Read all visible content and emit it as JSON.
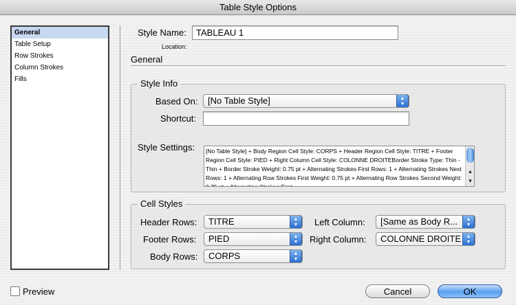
{
  "window": {
    "title": "Table Style Options"
  },
  "sidebar": {
    "items": [
      {
        "label": "General",
        "selected": true
      },
      {
        "label": "Table Setup"
      },
      {
        "label": "Row Strokes"
      },
      {
        "label": "Column Strokes"
      },
      {
        "label": "Fills"
      }
    ]
  },
  "style_name": {
    "label": "Style Name:",
    "value": "TABLEAU 1"
  },
  "location": {
    "label": "Location:"
  },
  "section_title": "General",
  "style_info": {
    "title": "Style Info",
    "based_on_label": "Based On:",
    "based_on_value": "[No Table Style]",
    "shortcut_label": "Shortcut:",
    "shortcut_value": "",
    "settings_label": "Style Settings:",
    "settings_text": "[No Table Style] + Body Region Cell Style: CORPS + Header Region Cell Style: TITRE + Footer Region Cell Style: PIED + Right Column Cell Style: COLONNE DROITEBorder Stroke Type: Thin - Thin + Border Stroke Weight: 0.75 pt + Alternating Strokes First Rows: 1 + Alternating Strokes Next Rows: 1 + Alternating Row Strokes First Weight: 0.75 pt + Alternating Row Strokes Second Weight: 0.75 pt + Alternating Strokes First"
  },
  "cell_styles": {
    "title": "Cell Styles",
    "header_rows_label": "Header Rows:",
    "header_rows_value": "TITRE",
    "footer_rows_label": "Footer Rows:",
    "footer_rows_value": "PIED",
    "body_rows_label": "Body Rows:",
    "body_rows_value": "CORPS",
    "left_column_label": "Left Column:",
    "left_column_value": "[Same as Body R...",
    "right_column_label": "Right Column:",
    "right_column_value": "COLONNE DROITE"
  },
  "preview": {
    "label": "Preview",
    "checked": false
  },
  "buttons": {
    "cancel": "Cancel",
    "ok": "OK"
  },
  "icons": {
    "popup": "up-down-arrows-icon",
    "scroll_up": "scroll-up-arrow-icon",
    "scroll_down": "scroll-down-arrow-icon"
  },
  "colors": {
    "accent": "#3d86e6",
    "selection": "#c7d8f0"
  }
}
